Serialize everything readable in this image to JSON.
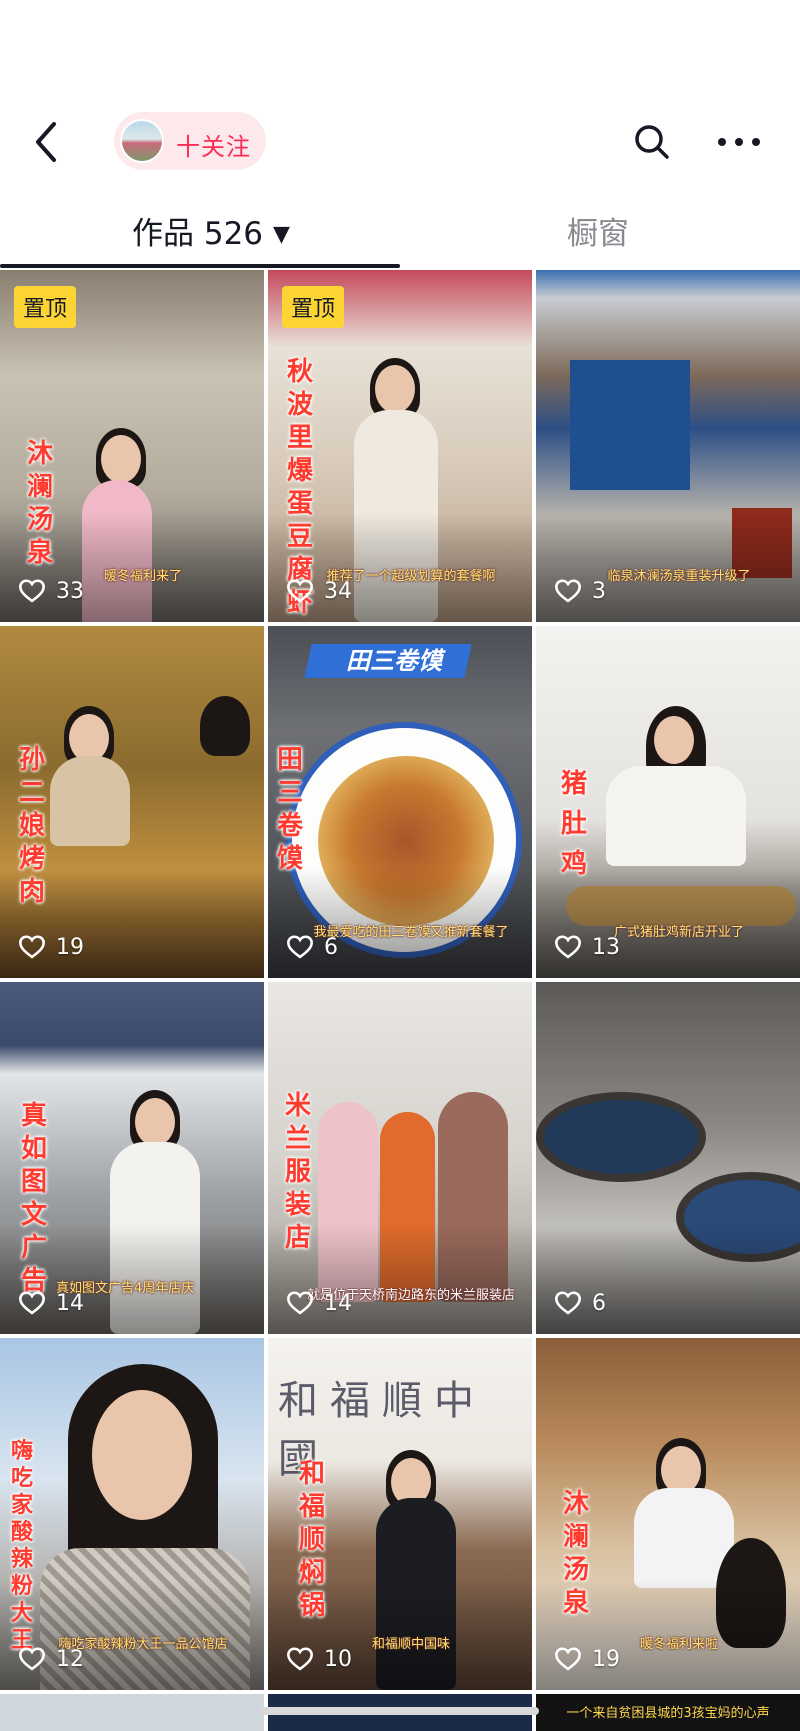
{
  "header": {
    "follow_label": "十关注",
    "icons": {
      "back": "back-chevron-icon",
      "search": "search-icon",
      "more": "more-dots-icon"
    }
  },
  "tabs": {
    "works_label": "作品 526",
    "window_label": "橱窗"
  },
  "colors": {
    "accent": "#fe2c55",
    "pin": "#fcd535",
    "text": "#161823",
    "muted": "#8a8b91"
  },
  "videos": [
    {
      "pinned": true,
      "pin_label": "置顶",
      "overlay": "沐澜汤泉",
      "subtitle": "暖冬福利来了",
      "likes": "33"
    },
    {
      "pinned": true,
      "pin_label": "置顶",
      "overlay": "秋波里爆蛋豆腐虾",
      "subtitle": "推荐了一个超级划算的套餐啊",
      "likes": "34"
    },
    {
      "pinned": false,
      "overlay": "",
      "subtitle": "临泉沐澜汤泉重装升级了",
      "likes": "3"
    },
    {
      "pinned": false,
      "overlay": "孙二娘烤肉",
      "subtitle": "",
      "likes": "19"
    },
    {
      "pinned": false,
      "overlay": "田三卷馍",
      "top_title": "田三卷馍",
      "subtitle": "我最爱吃的田三卷馍又推新套餐了",
      "likes": "6"
    },
    {
      "pinned": false,
      "overlay": "猪肚鸡",
      "subtitle": "广式猪肚鸡新店开业了",
      "likes": "13"
    },
    {
      "pinned": false,
      "overlay": "真如图文广告",
      "subtitle": "真如图文广告4周年店庆",
      "likes": "14"
    },
    {
      "pinned": false,
      "overlay": "米兰服装店",
      "subtitle": "就是位于天桥南边路东的米兰服装店",
      "likes": "14"
    },
    {
      "pinned": false,
      "overlay": "",
      "subtitle": "",
      "likes": "6"
    },
    {
      "pinned": false,
      "overlay": "嗨吃家酸辣粉大王",
      "subtitle": "嗨吃家酸辣粉大王一品公馆店",
      "likes": "12"
    },
    {
      "pinned": false,
      "overlay": "和福顺焖锅",
      "subtitle": "和福顺中国味",
      "likes": "10"
    },
    {
      "pinned": false,
      "overlay": "沐澜汤泉",
      "subtitle": "暖冬福利来啦",
      "likes": "19"
    }
  ],
  "partial_row": {
    "third_caption": "一个来自贫困县城的3孩宝妈的心声"
  }
}
